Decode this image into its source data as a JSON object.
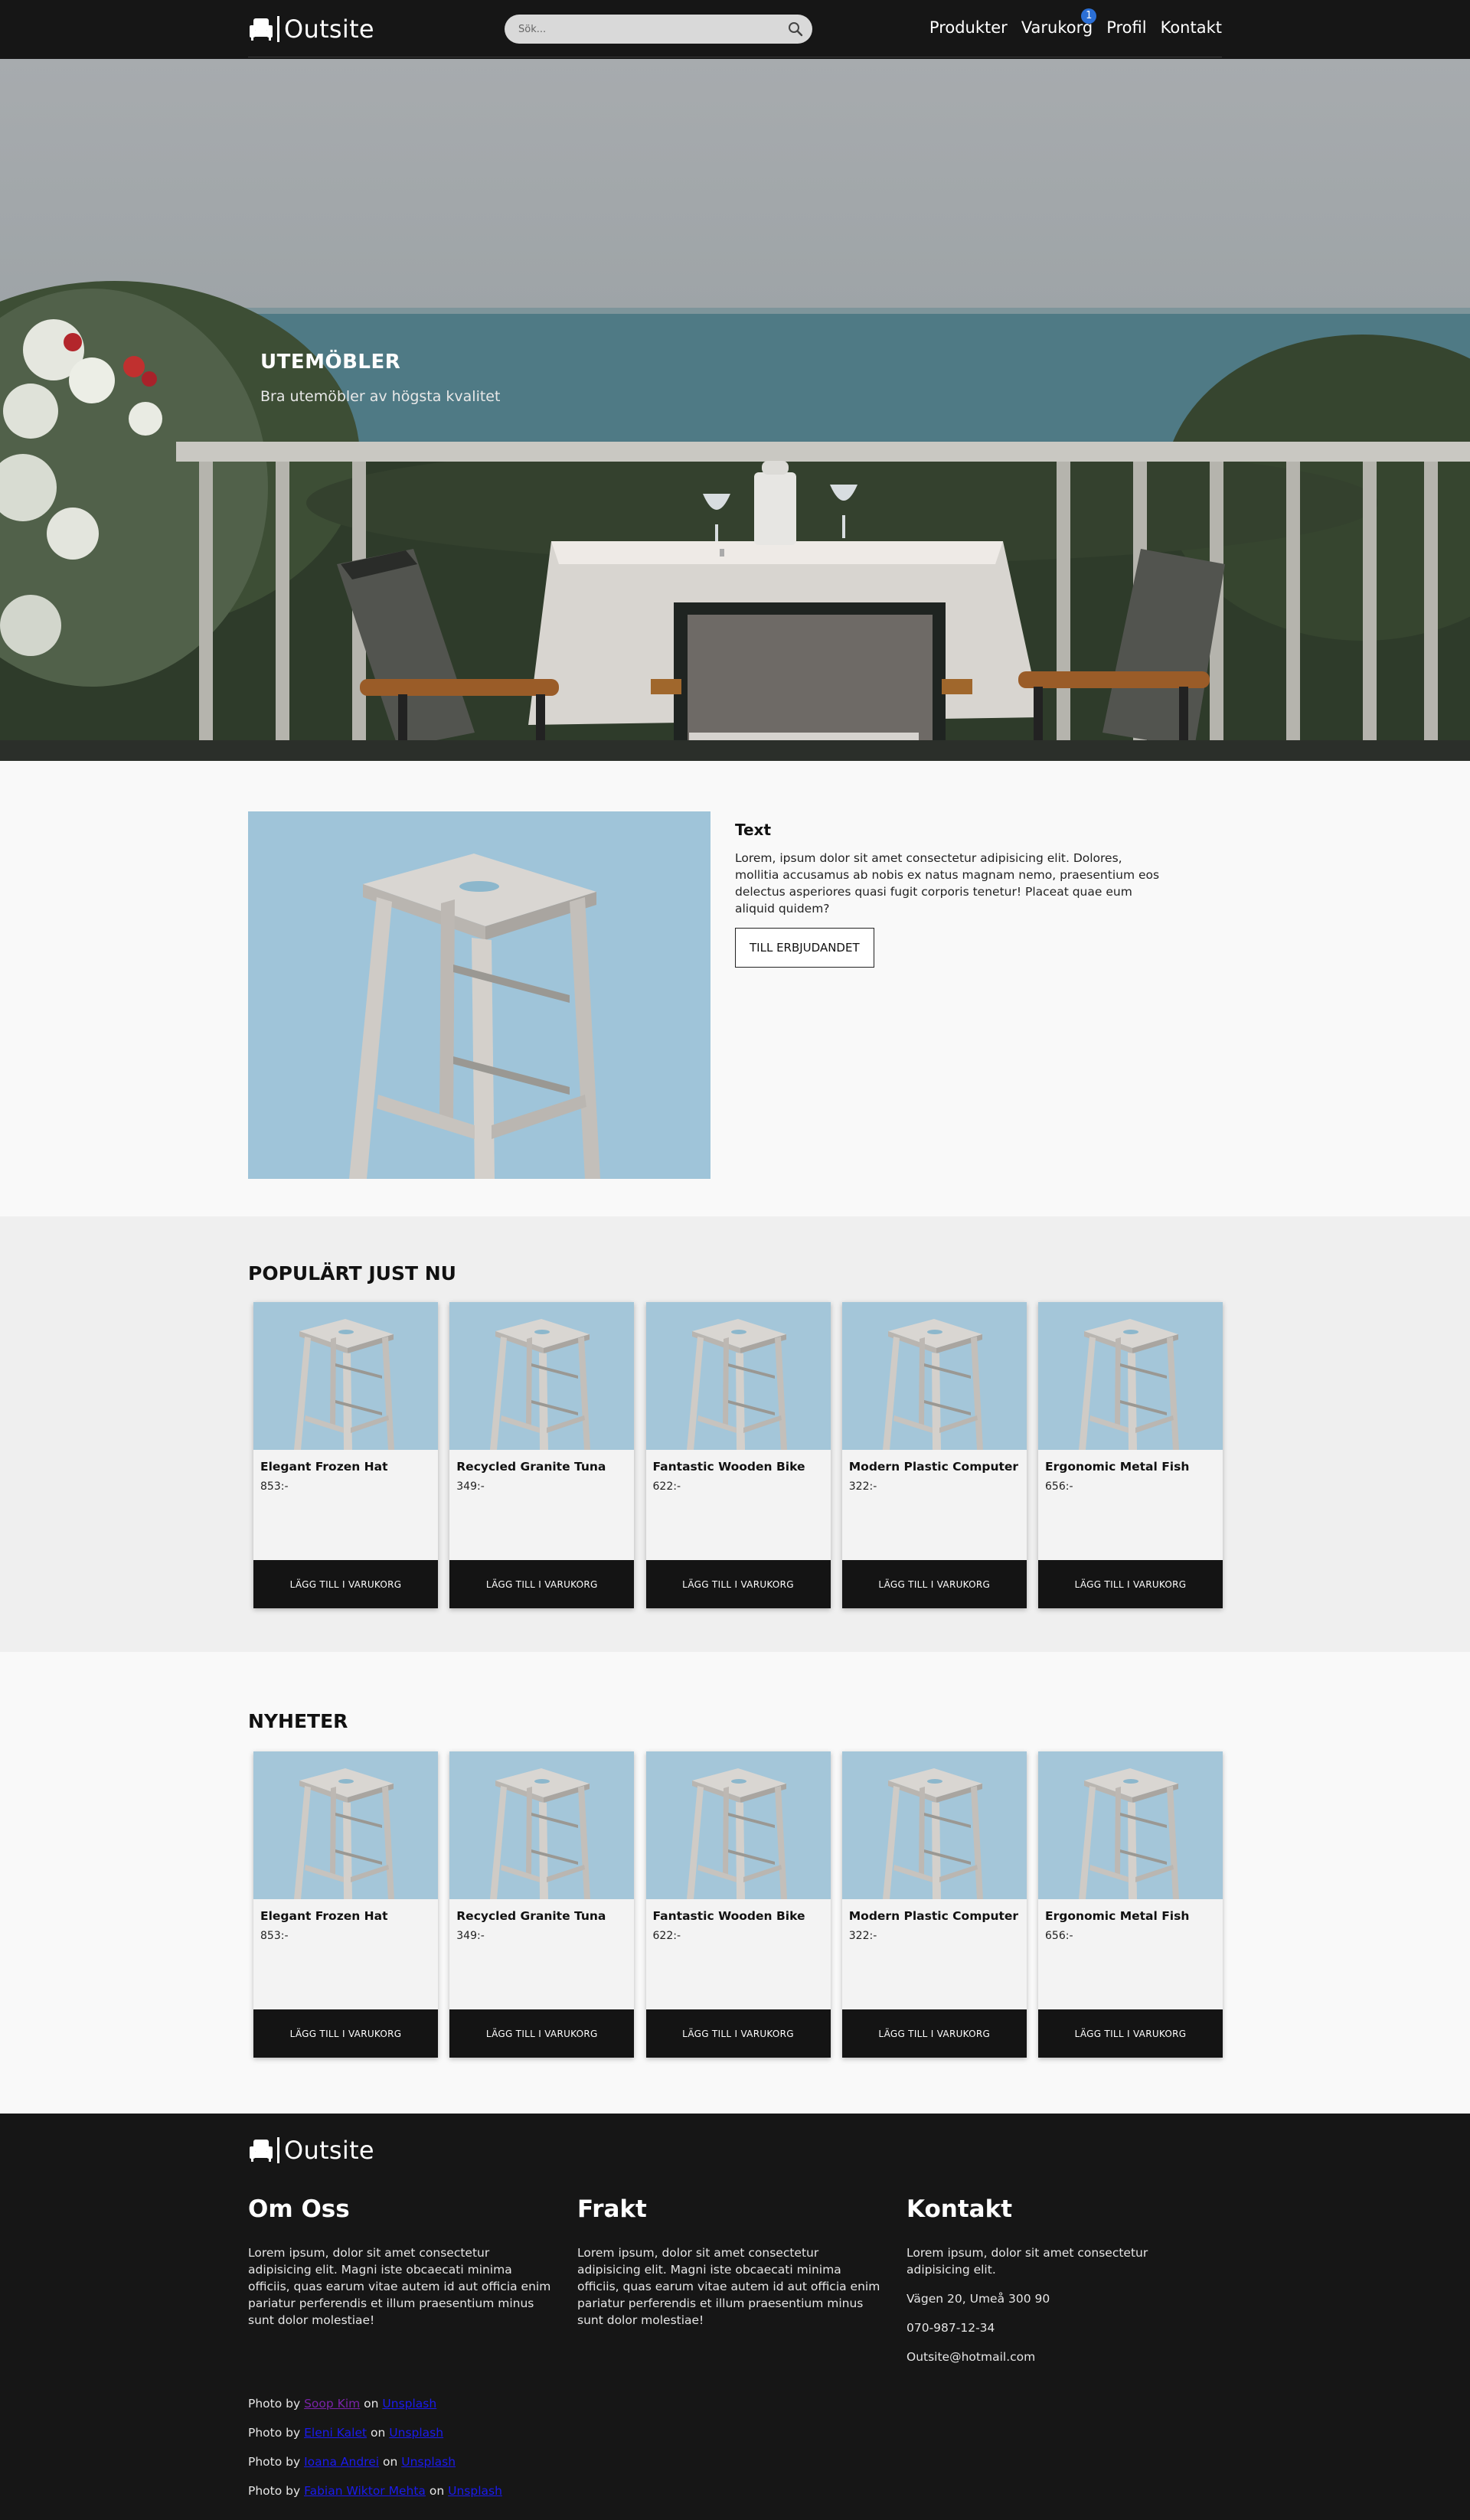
{
  "brand": {
    "name": "Outsite"
  },
  "search": {
    "placeholder": "Sök..."
  },
  "nav": {
    "links": [
      "Produkter",
      "Varukorg",
      "Profil",
      "Kontakt"
    ],
    "cart_count": "1"
  },
  "hero": {
    "title": "UTEMÖBLER",
    "subtitle": "Bra utemöbler av högsta kvalitet"
  },
  "feature": {
    "title": "Text",
    "body": "Lorem, ipsum dolor sit amet consectetur adipisicing elit. Dolores, mollitia accusamus ab nobis ex natus magnam nemo, praesentium eos delectus asperiores quasi fugit corporis tenetur! Placeat quae eum aliquid quidem?",
    "button_label": "TILL ERBJUDANDET"
  },
  "popular": {
    "title": "POPULÄRT JUST NU",
    "products": [
      {
        "name": "Elegant Frozen Hat",
        "price": "853:-",
        "button": "LÄGG TILL I VARUKORG"
      },
      {
        "name": "Recycled Granite Tuna",
        "price": "349:-",
        "button": "LÄGG TILL I VARUKORG"
      },
      {
        "name": "Fantastic Wooden Bike",
        "price": "622:-",
        "button": "LÄGG TILL I VARUKORG"
      },
      {
        "name": "Modern Plastic Computer",
        "price": "322:-",
        "button": "LÄGG TILL I VARUKORG"
      },
      {
        "name": "Ergonomic Metal Fish",
        "price": "656:-",
        "button": "LÄGG TILL I VARUKORG"
      }
    ]
  },
  "news": {
    "title": "NYHETER",
    "products": [
      {
        "name": "Elegant Frozen Hat",
        "price": "853:-",
        "button": "LÄGG TILL I VARUKORG"
      },
      {
        "name": "Recycled Granite Tuna",
        "price": "349:-",
        "button": "LÄGG TILL I VARUKORG"
      },
      {
        "name": "Fantastic Wooden Bike",
        "price": "622:-",
        "button": "LÄGG TILL I VARUKORG"
      },
      {
        "name": "Modern Plastic Computer",
        "price": "322:-",
        "button": "LÄGG TILL I VARUKORG"
      },
      {
        "name": "Ergonomic Metal Fish",
        "price": "656:-",
        "button": "LÄGG TILL I VARUKORG"
      }
    ]
  },
  "footer": {
    "about": {
      "title": "Om Oss",
      "text": "Lorem ipsum, dolor sit amet consectetur adipisicing elit. Magni iste obcaecati minima officiis, quas earum vitae autem id aut officia enim pariatur perferendis et illum praesentium minus sunt dolor molestiae!"
    },
    "shipping": {
      "title": "Frakt",
      "text": "Lorem ipsum, dolor sit amet consectetur adipisicing elit. Magni iste obcaecati minima officiis, quas earum vitae autem id aut officia enim pariatur perferendis et illum praesentium minus sunt dolor molestiae!"
    },
    "contact": {
      "title": "Kontakt",
      "text": "Lorem ipsum, dolor sit amet consectetur adipisicing elit.",
      "address": "Vägen 20, Umeå 300 90",
      "phone": "070-987-12-34",
      "email": "Outsite@hotmail.com"
    },
    "credits": [
      {
        "prefix": "Photo by",
        "author": "Soop Kim",
        "joiner": "on",
        "site": "Unsplash"
      },
      {
        "prefix": "Photo by",
        "author": "Eleni Kalet",
        "joiner": "on",
        "site": "Unsplash"
      },
      {
        "prefix": "Photo by",
        "author": "Ioana Andrei",
        "joiner": "on",
        "site": "Unsplash"
      },
      {
        "prefix": "Photo by",
        "author": "Fabian Wiktor Mehta",
        "joiner": "on",
        "site": "Unsplash"
      }
    ]
  },
  "colors": {
    "navbar": "#161616",
    "badge": "#2b6fd6",
    "button_dark": "#141414",
    "link": "#1a1aee",
    "link_visited": "#7a23a8"
  },
  "icons": [
    "armchair-logo-icon",
    "search-icon"
  ]
}
